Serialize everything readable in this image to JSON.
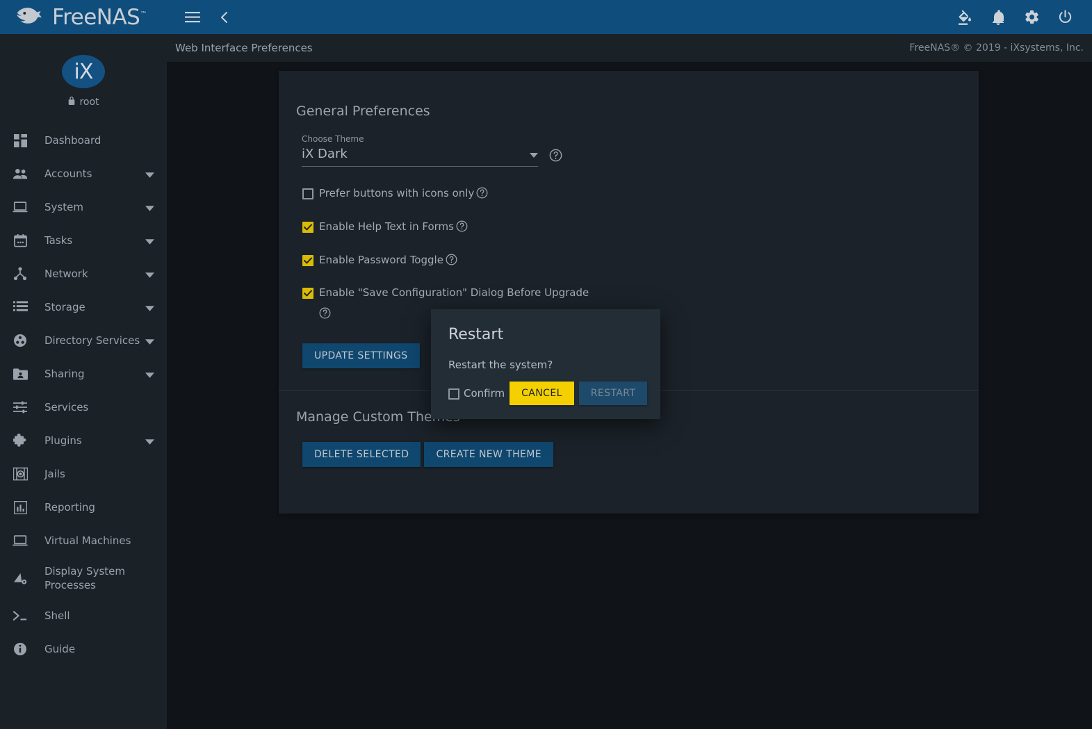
{
  "topbar": {
    "brand_name": "FreeNAS",
    "brand_tm": "™",
    "menu_icon": "hamburger-menu-icon",
    "back_icon": "chevron-left-icon",
    "theme_icon": "paint-bucket-icon",
    "notifications_icon": "bell-icon",
    "settings_icon": "gear-icon",
    "power_icon": "power-icon"
  },
  "sidebar": {
    "avatar_text": "iX",
    "username": "root",
    "lock_icon": "lock-icon",
    "items": [
      {
        "label": "Dashboard",
        "icon": "dashboard-icon",
        "expandable": false
      },
      {
        "label": "Accounts",
        "icon": "people-icon",
        "expandable": true
      },
      {
        "label": "System",
        "icon": "laptop-icon",
        "expandable": true
      },
      {
        "label": "Tasks",
        "icon": "calendar-icon",
        "expandable": true
      },
      {
        "label": "Network",
        "icon": "network-icon",
        "expandable": true
      },
      {
        "label": "Storage",
        "icon": "storage-list-icon",
        "expandable": true
      },
      {
        "label": "Directory Services",
        "icon": "directory-services-icon",
        "expandable": true
      },
      {
        "label": "Sharing",
        "icon": "folder-share-icon",
        "expandable": true
      },
      {
        "label": "Services",
        "icon": "sliders-icon",
        "expandable": false
      },
      {
        "label": "Plugins",
        "icon": "puzzle-piece-icon",
        "expandable": true
      },
      {
        "label": "Jails",
        "icon": "jails-icon",
        "expandable": false
      },
      {
        "label": "Reporting",
        "icon": "bar-chart-icon",
        "expandable": false
      },
      {
        "label": "Virtual Machines",
        "icon": "monitor-icon",
        "expandable": false
      },
      {
        "label": "Display System Processes",
        "icon": "processes-icon",
        "expandable": false
      },
      {
        "label": "Shell",
        "icon": "terminal-prompt-icon",
        "expandable": false
      },
      {
        "label": "Guide",
        "icon": "info-circle-icon",
        "expandable": false
      }
    ]
  },
  "subheader": {
    "title": "Web Interface Preferences",
    "copyright": "FreeNAS® © 2019 - iXsystems, Inc."
  },
  "preferences": {
    "section_title": "General Preferences",
    "theme": {
      "label": "Choose Theme",
      "value": "iX Dark",
      "dropdown_icon": "chevron-down-icon",
      "help_icon": "help-circle-icon"
    },
    "checkboxes": [
      {
        "label": "Prefer buttons with icons only",
        "checked": false,
        "help_icon": "help-circle-icon"
      },
      {
        "label": "Enable Help Text in Forms",
        "checked": true,
        "help_icon": "help-circle-icon"
      },
      {
        "label": "Enable Password Toggle",
        "checked": true,
        "help_icon": "help-circle-icon"
      },
      {
        "label": "Enable \"Save Configuration\" Dialog Before Upgrade",
        "checked": true,
        "help_icon": "help-circle-icon"
      }
    ],
    "update_settings_label": "UPDATE SETTINGS"
  },
  "custom_themes": {
    "section_title": "Manage Custom Themes",
    "delete_selected_label": "DELETE SELECTED",
    "create_new_theme_label": "CREATE NEW THEME"
  },
  "dialog": {
    "title": "Restart",
    "message": "Restart the system?",
    "confirm_label": "Confirm",
    "confirm_checked": false,
    "cancel_label": "CANCEL",
    "restart_label": "RESTART",
    "restart_disabled": true
  },
  "colors": {
    "topbar": "#0f4d7d",
    "sidebar": "#1a2127",
    "page_background": "#101419",
    "card": "#1b2229",
    "dialog": "#232d36",
    "checkbox_checked": "#d9bc07",
    "button_primary": "#10476f",
    "button_warn": "#f5d000",
    "text_primary": "#b3bbc4"
  }
}
